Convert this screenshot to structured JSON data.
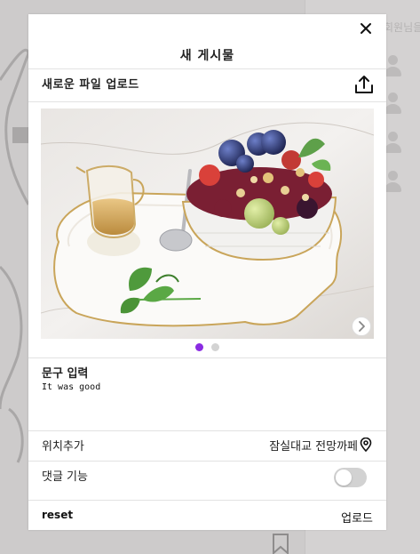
{
  "background": {
    "right_text": "회원님을"
  },
  "modal": {
    "title": "새 게시물",
    "upload": {
      "label": "새로운 파일 업로드"
    },
    "carousel": {
      "slide_count": 2,
      "active_index": 0
    },
    "caption": {
      "label": "문구 입력",
      "value": "It was good"
    },
    "location": {
      "label": "위치추가",
      "value": "잠실대교 전망까페"
    },
    "comments": {
      "label": "댓글 기능",
      "enabled": false
    },
    "footer": {
      "reset_label": "reset",
      "submit_label": "업로드"
    }
  },
  "colors": {
    "accent": "#8a2be2",
    "toggle_off": "#d2d2d2",
    "dot_inactive": "#d3d3d3"
  },
  "icons": [
    "close-icon",
    "upload-icon",
    "chevron-right-icon",
    "location-pin-icon",
    "bookmark-icon"
  ]
}
